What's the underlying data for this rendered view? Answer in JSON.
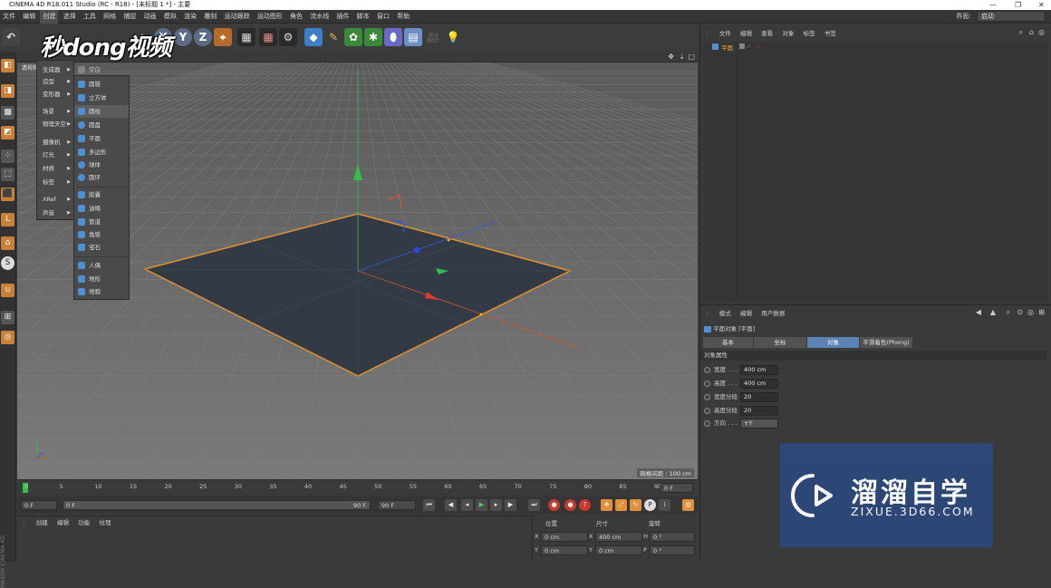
{
  "window": {
    "title": "CINEMA 4D R18.011 Studio (RC - R18) - [未标题 1 *] - 主要",
    "min": "—",
    "restore": "❐",
    "close": "✕"
  },
  "menubar": {
    "items": [
      "文件",
      "编辑",
      "创建",
      "选择",
      "工具",
      "网格",
      "捕捉",
      "动画",
      "模拟",
      "渲染",
      "雕刻",
      "运动跟踪",
      "运动图形",
      "角色",
      "流水线",
      "插件",
      "脚本",
      "窗口",
      "帮助"
    ],
    "interface_label": "界面:",
    "interface_value": "启动"
  },
  "watermark_top": "秒dong视频",
  "create_menu": {
    "items": [
      "生成器",
      "造型",
      "变形器",
      "场景",
      "物理天空",
      "摄像机",
      "灯光",
      "材质",
      "标签",
      "XRef",
      "声音"
    ]
  },
  "object_submenu": {
    "header": "空白",
    "items": [
      "圆锥",
      "立方体",
      "圆柱",
      "圆盘",
      "平面",
      "多边形",
      "球体",
      "圆环",
      "胶囊",
      "油桶",
      "管道",
      "角锥",
      "宝石",
      "人偶",
      "地形",
      "地貌"
    ]
  },
  "viewport": {
    "tab_label": "透视视图",
    "grid_spacing": "网格间距 : 100 cm"
  },
  "timeline": {
    "ticks": [
      "0",
      "5",
      "10",
      "15",
      "20",
      "25",
      "30",
      "35",
      "40",
      "45",
      "50",
      "55",
      "60",
      "65",
      "70",
      "75",
      "80",
      "85",
      "90"
    ],
    "end_frame_field": "0 F",
    "current_frame": "0 F",
    "range_start": "0 F",
    "range_end": "90 F",
    "max_frame": "90 F"
  },
  "material_menu": [
    "创建",
    "编辑",
    "功能",
    "纹理"
  ],
  "coord_panel": {
    "headers": [
      "位置",
      "尺寸",
      "旋转"
    ],
    "rows": [
      {
        "axis": "X",
        "pos": "0 cm",
        "size_axis": "X",
        "size": "400 cm",
        "rot_axis": "H",
        "rot": "0 °"
      },
      {
        "axis": "Y",
        "pos": "0 cm",
        "size_axis": "Y",
        "size": "0 cm",
        "rot_axis": "P",
        "rot": "0 °"
      }
    ]
  },
  "object_manager": {
    "menu": [
      "文件",
      "编辑",
      "查看",
      "对象",
      "标签",
      "书签"
    ],
    "objects": [
      {
        "name": "平面"
      }
    ]
  },
  "attribute_manager": {
    "menu": [
      "模式",
      "编辑",
      "用户数据"
    ],
    "object_title": "平面对象 [平面]",
    "tabs": [
      "基本",
      "坐标",
      "对象",
      "平滑着色(Phong)"
    ],
    "section": "对象属性",
    "props": [
      {
        "label": "宽度 . . .",
        "value": "400 cm"
      },
      {
        "label": "高度 . . .",
        "value": "400 cm"
      },
      {
        "label": "宽度分段",
        "value": "20"
      },
      {
        "label": "高度分段",
        "value": "20"
      },
      {
        "label": "方向 . . .",
        "value": "+Y"
      }
    ]
  },
  "watermark_br": {
    "title": "溜溜自学",
    "url": "ZIXUE.3D66.COM"
  },
  "side_label": "MAXON CINEMA 4D",
  "colors": {
    "accent": "#5a82b5",
    "plane_edge": "#e2912f",
    "watermark_bg": "#2c4878"
  }
}
